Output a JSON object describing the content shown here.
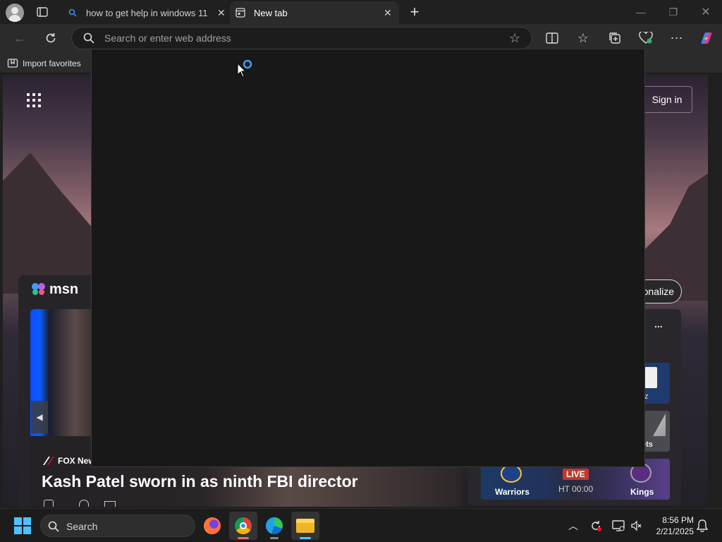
{
  "browser": {
    "tabs": [
      {
        "label": "how to get help in windows 11 -",
        "active": false
      },
      {
        "label": "New tab",
        "active": true
      }
    ],
    "address_bar": {
      "placeholder": "Search or enter web address",
      "value": ""
    },
    "favorites_bar": {
      "import_label": "Import favorites"
    }
  },
  "new_tab_page": {
    "sign_in_label": "Sign in",
    "msn_logo_text": "msn",
    "personalize_label_partial": "onalize",
    "more_label": "...",
    "headline": {
      "source": "FOX New",
      "title": "Kash Patel sworn in as ninth FBI director"
    },
    "scores": {
      "team_home": "Warriors",
      "team_away": "Kings",
      "status": "LIVE",
      "time": "HT 00:00",
      "partial_label_1": "z",
      "partial_label_2": "ets"
    }
  },
  "taskbar": {
    "search_label": "Search",
    "clock_time": "8:56 PM",
    "clock_date": "2/21/2025"
  },
  "colors": {
    "accent": "#4cc2ff",
    "live_badge": "#c0392b",
    "chrome_bg": "#202020",
    "toolbar_bg": "#2b2b2b",
    "dropdown_bg": "#181818"
  }
}
